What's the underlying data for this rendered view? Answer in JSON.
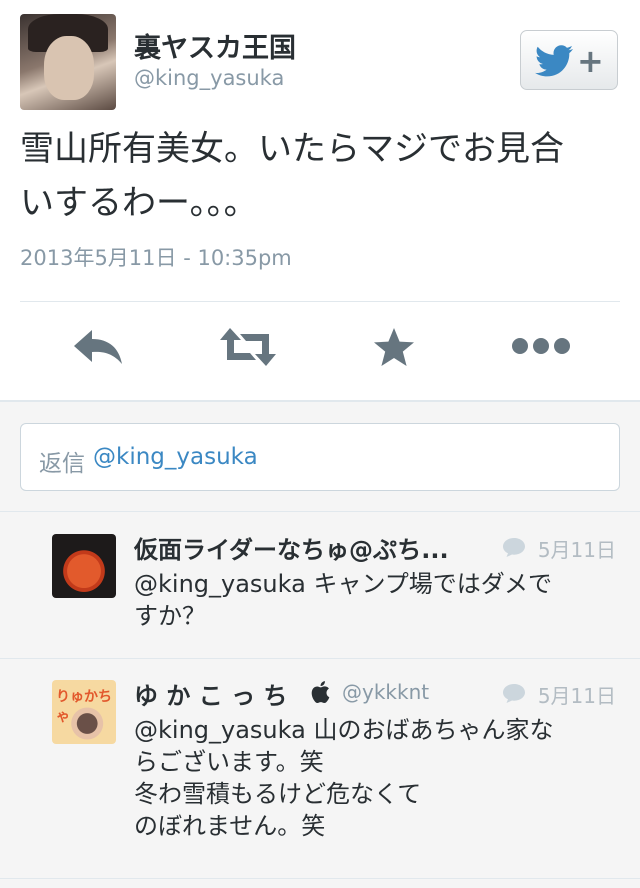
{
  "tweet": {
    "author_name": "裏ヤスカ王国",
    "author_handle": "@king_yasuka",
    "text_line1": "雪山所有美女。いたらマジでお見合",
    "text_line2": "いするわー。。。",
    "timestamp": "2013年5月11日 - 10:35pm",
    "follow_plus": "+",
    "actions": [
      "reply-icon",
      "retweet-icon",
      "favorite-icon",
      "more-icon"
    ]
  },
  "reply_box": {
    "prefix": "返信",
    "mention": "@king_yasuka"
  },
  "replies": [
    {
      "name": "仮面ライダーなちゅ@ぷち...",
      "handle": "",
      "date": "5月11日",
      "line1": "@king_yasuka キャンプ場ではダメで",
      "line2": "すか？"
    },
    {
      "name": "ゆ か こ っ ち",
      "handle": "@ykkknt",
      "date": "5月11日",
      "line1": "@king_yasuka 山のおばあちゃん家な",
      "line2": "らございます。笑",
      "line3": "冬わ雪積もるけど危なくて",
      "line4": "のぼれません。笑",
      "avatar_scrawl": "りゅかちゃ"
    }
  ],
  "colors": {
    "twitter_blue": "#3b88c3",
    "gray_text": "#8899a6",
    "icon_gray": "#66757f"
  }
}
